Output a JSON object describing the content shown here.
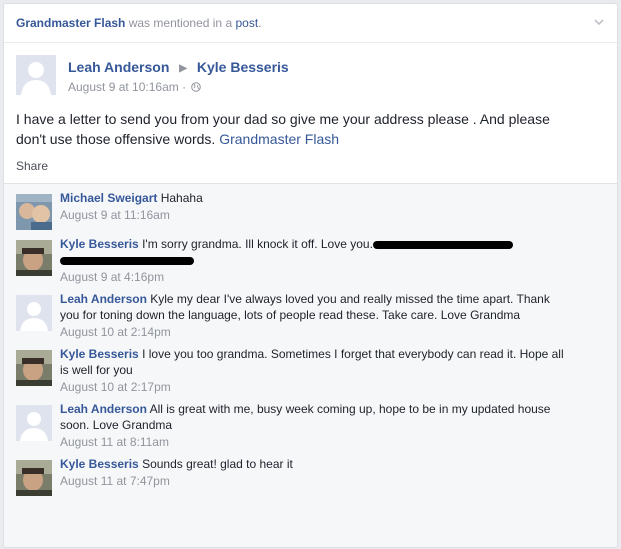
{
  "header": {
    "mention_name": "Grandmaster Flash",
    "mention_text": "was mentioned in a",
    "post_link": "post",
    "period": "."
  },
  "post": {
    "author": "Leah Anderson",
    "recipient": "Kyle Besseris",
    "timestamp": "August 9 at 10:16am",
    "dot": "·",
    "text": "I have a letter to send you from your dad so give me your address please . And please don't use those offensive words.",
    "tag": "Grandmaster Flash",
    "share_label": "Share"
  },
  "comments": [
    {
      "author": "Michael Sweigart",
      "text": "Hahaha",
      "time": "August 9 at 11:16am"
    },
    {
      "author": "Kyle Besseris",
      "text": "I'm sorry grandma. Ill knock it off. Love you.",
      "time": "August 9 at 4:16pm"
    },
    {
      "author": "Leah Anderson",
      "text": "Kyle my dear I've always loved you and really missed the time apart. Thank you for toning down the language, lots of people read these. Take care. Love Grandma",
      "time": "August 10 at 2:14pm"
    },
    {
      "author": "Kyle Besseris",
      "text": "I love you too grandma. Sometimes I forget that everybody can read it. Hope all is well for you",
      "time": "August 10 at 2:17pm"
    },
    {
      "author": "Leah Anderson",
      "text": "All is great with me, busy week coming up, hope to be in my updated house soon. Love Grandma",
      "time": "August 11 at 8:11am"
    },
    {
      "author": "Kyle Besseris",
      "text": "Sounds great! glad to hear it",
      "time": "August 11 at 7:47pm"
    }
  ],
  "colors": {
    "link": "#365899",
    "meta": "#90949c",
    "comments_bg": "#f6f7f9"
  },
  "icons": [
    "chevron-down-icon",
    "triangle-right-icon",
    "globe-icon",
    "default-avatar-icon"
  ]
}
